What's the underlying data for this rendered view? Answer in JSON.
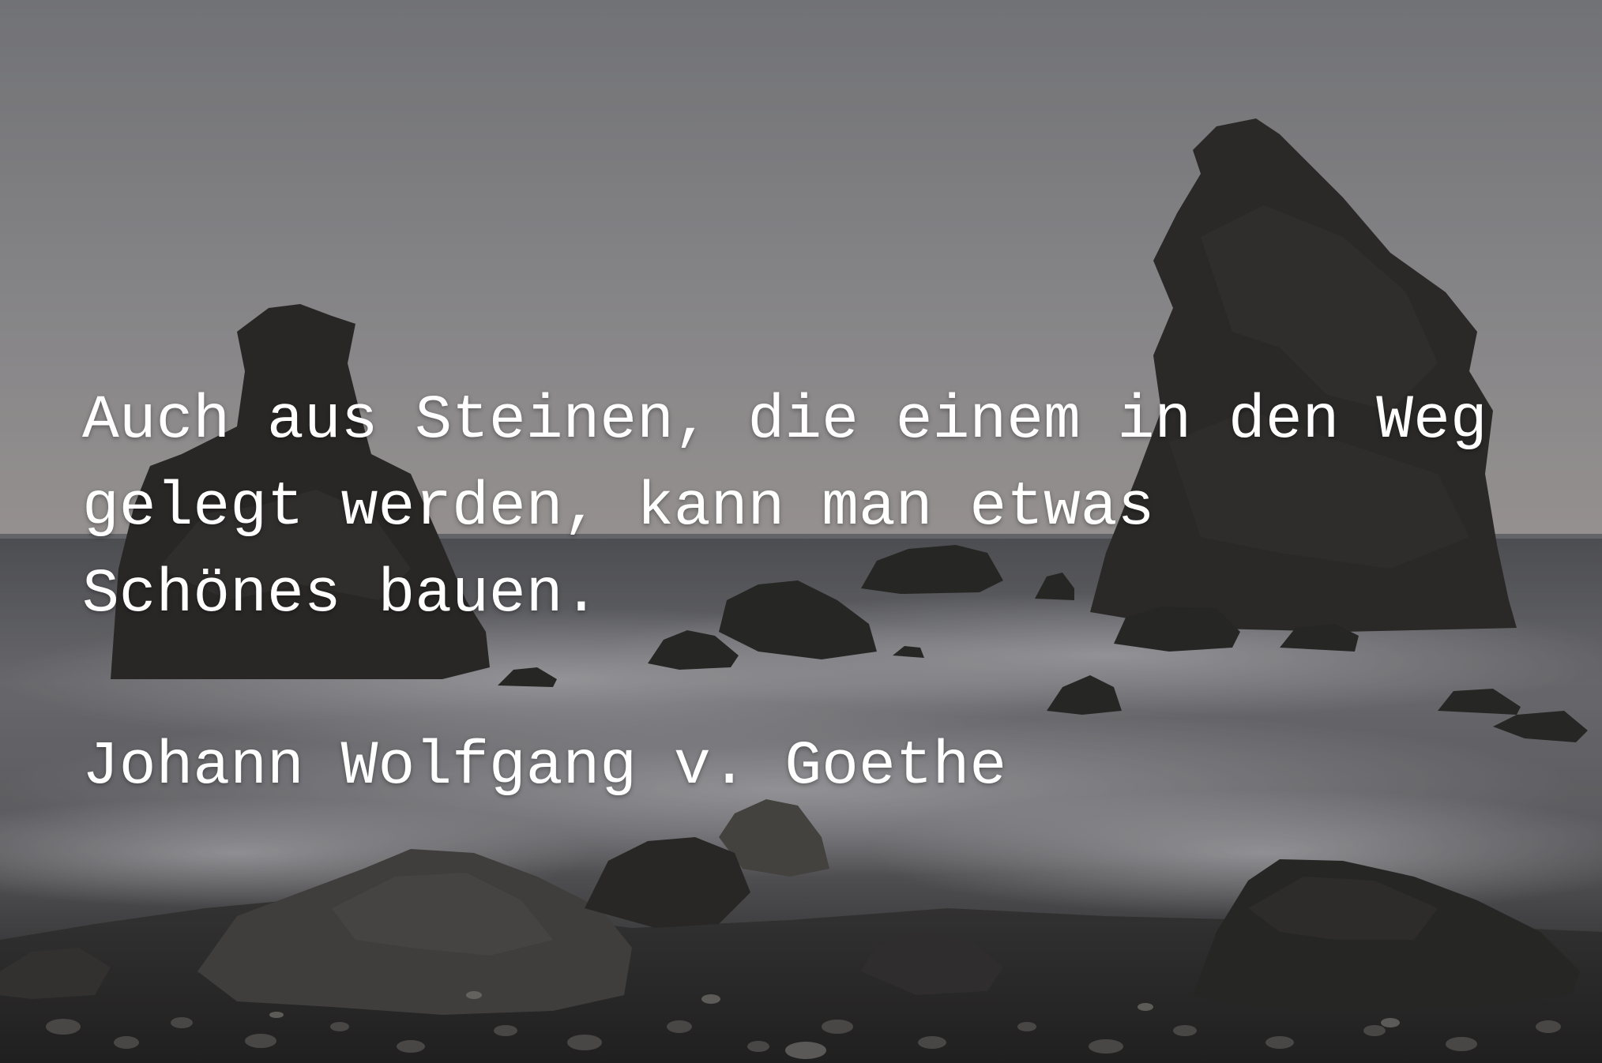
{
  "quote": {
    "lines": [
      "Auch aus Steinen, die einem in den Weg",
      "gelegt werden, kann man etwas",
      "Schönes bauen."
    ],
    "author": "Johann Wolfgang v. Goethe"
  },
  "colors": {
    "sky_top": "#8a8b90",
    "sky_horizon": "#b5b1b2",
    "sea": "#6c6c70",
    "foam": "#a9a9ae",
    "rock": "#2e2c2b",
    "text": "#ffffff"
  }
}
